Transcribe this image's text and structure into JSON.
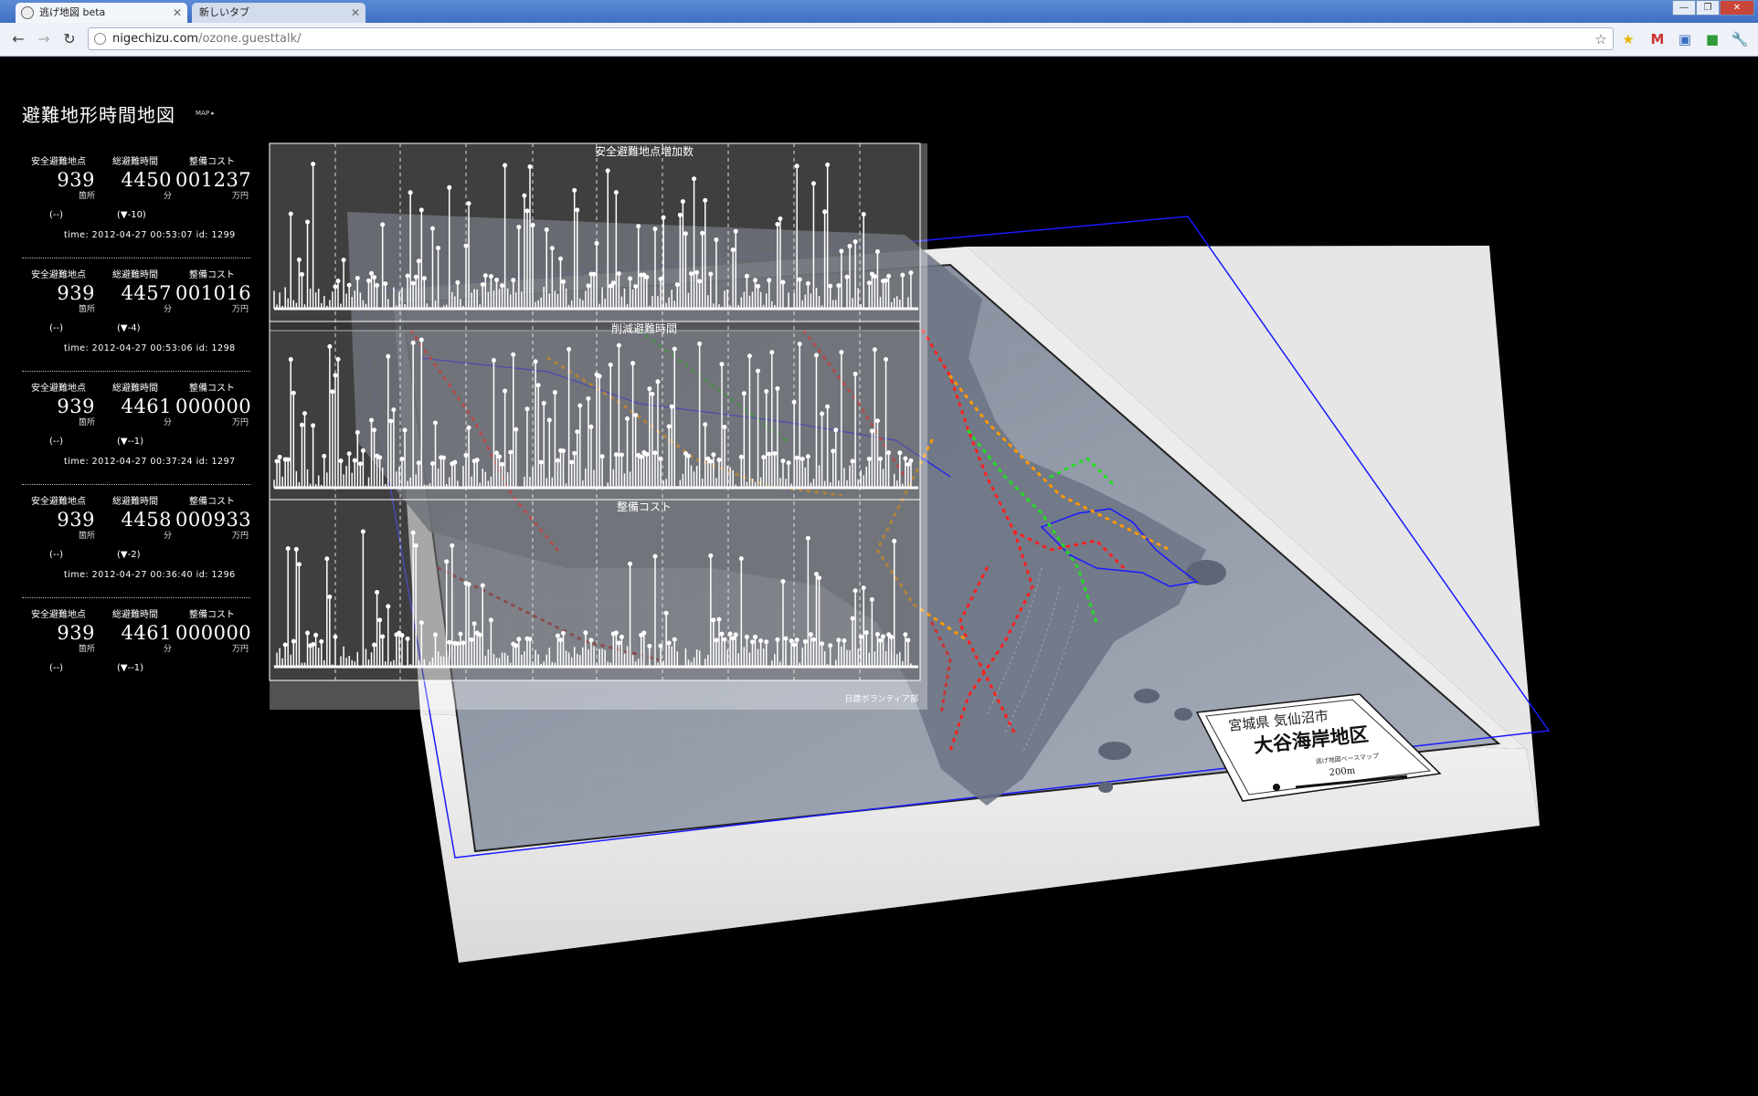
{
  "browser": {
    "tabs": [
      {
        "label": "逃げ地図 beta",
        "active": true
      },
      {
        "label": "新しいタブ",
        "active": false
      }
    ],
    "url_domain": "nigechizu.com",
    "url_path": "/ozone.guesttalk/",
    "window_controls": [
      "—",
      "❐",
      "✕"
    ]
  },
  "page": {
    "title": "避難地形時間地図",
    "map_link": "MAP ▸"
  },
  "log_headers": {
    "safe_points": "安全避難地点",
    "total_time": "総避難時間",
    "cost": "整備コスト"
  },
  "log_units": {
    "safe_points": "箇所",
    "total_time": "分",
    "cost": "万円"
  },
  "log_entries": [
    {
      "safe_points": "939",
      "total_time": "4450",
      "cost": "001237",
      "delta_a": "(--)",
      "delta_b": "(▼-10)",
      "timestamp": "time: 2012-04-27 00:53:07 id: 1299"
    },
    {
      "safe_points": "939",
      "total_time": "4457",
      "cost": "001016",
      "delta_a": "(--)",
      "delta_b": "(▼-4)",
      "timestamp": "time: 2012-04-27 00:53:06 id: 1298"
    },
    {
      "safe_points": "939",
      "total_time": "4461",
      "cost": "000000",
      "delta_a": "(--)",
      "delta_b": "(▼--1)",
      "timestamp": "time: 2012-04-27 00:37:24 id: 1297"
    },
    {
      "safe_points": "939",
      "total_time": "4458",
      "cost": "000933",
      "delta_a": "(--)",
      "delta_b": "(▼-2)",
      "timestamp": "time: 2012-04-27 00:36:40 id: 1296"
    },
    {
      "safe_points": "939",
      "total_time": "4461",
      "cost": "000000",
      "delta_a": "(--)",
      "delta_b": "(▼--1)",
      "timestamp": ""
    }
  ],
  "chart_data": [
    {
      "type": "bar",
      "title": "安全避難地点増加数"
    },
    {
      "type": "bar",
      "title": "削減避難時間"
    },
    {
      "type": "bar",
      "title": "整備コスト"
    }
  ],
  "panel_credit": "日建ボランティア部",
  "map_legend": {
    "prefecture": "宮城県 気仙沼市",
    "district": "大谷海岸地区",
    "subtitle": "逃げ地図ベースマップ",
    "scale": "200m"
  },
  "colors": {
    "chrome_blue": "#4f7fcf",
    "map_surface": "#8f97a6",
    "boundary": "#1a1aff",
    "route_red": "#ff2020",
    "route_green": "#22dd22",
    "route_orange": "#ff9900"
  }
}
